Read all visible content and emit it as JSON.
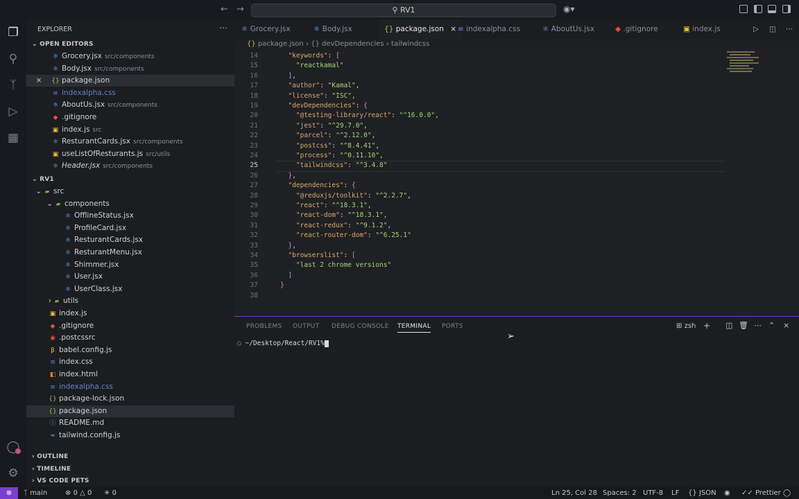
{
  "title": "RV1",
  "sidebar": {
    "header": "EXPLORER",
    "open_editors_label": "OPEN EDITORS",
    "open_editors": [
      {
        "name": "Grocery.jsx",
        "desc": "src/components",
        "icon": "react-icon",
        "color": "#5fb3ff"
      },
      {
        "name": "Body.jsx",
        "desc": "src/components",
        "icon": "react-icon",
        "color": "#5fb3ff"
      },
      {
        "name": "package.json",
        "desc": "",
        "icon": "json-icon",
        "color": "#c8b45a"
      },
      {
        "name": "indexalpha.css",
        "desc": "",
        "icon": "css-icon",
        "color": "#5a84e6"
      },
      {
        "name": "AboutUs.jsx",
        "desc": "src/components",
        "icon": "react-icon",
        "color": "#5fb3ff"
      },
      {
        "name": ".gitignore",
        "desc": "",
        "icon": "git-icon",
        "color": "#e0503a"
      },
      {
        "name": "index.js",
        "desc": "src",
        "icon": "js-icon",
        "color": "#e6c03a"
      },
      {
        "name": "ResturantCards.jsx",
        "desc": "src/components",
        "icon": "react-icon",
        "color": "#5fb3ff"
      },
      {
        "name": "useListOfResturants.js",
        "desc": "src/utils",
        "icon": "js-icon",
        "color": "#e6c03a"
      },
      {
        "name": "Header.jsx",
        "desc": "src/components",
        "icon": "react-icon",
        "color": "#5fb3ff"
      }
    ],
    "project_label": "RV1",
    "tree": [
      {
        "name": "src",
        "icon": "folder-icon",
        "color": "#6aa84f"
      },
      {
        "name": "components",
        "icon": "folder-icon",
        "color": "#6aa84f"
      },
      {
        "name": "OfflineStatus.jsx",
        "icon": "react-icon",
        "color": "#5fb3ff"
      },
      {
        "name": "ProfileCard.jsx",
        "icon": "react-icon",
        "color": "#5fb3ff"
      },
      {
        "name": "ResturantCards.jsx",
        "icon": "react-icon",
        "color": "#5fb3ff"
      },
      {
        "name": "ResturantMenu.jsx",
        "icon": "react-icon",
        "color": "#5fb3ff"
      },
      {
        "name": "Shimmer.jsx",
        "icon": "react-icon",
        "color": "#5fb3ff"
      },
      {
        "name": "User.jsx",
        "icon": "react-icon",
        "color": "#5fb3ff"
      },
      {
        "name": "UserClass.jsx",
        "icon": "react-icon",
        "color": "#5fb3ff"
      },
      {
        "name": "utils",
        "icon": "folder-icon",
        "color": "#6aa84f"
      },
      {
        "name": "index.js",
        "icon": "js-icon",
        "color": "#e6c03a"
      },
      {
        "name": ".gitignore",
        "icon": "git-icon",
        "color": "#e0503a"
      },
      {
        "name": ".postcssrc",
        "icon": "postcss-icon",
        "color": "#e0503a"
      },
      {
        "name": "babel.config.js",
        "icon": "babel-icon",
        "color": "#e6c03a"
      },
      {
        "name": "index.css",
        "icon": "css-icon",
        "color": "#5a84e6"
      },
      {
        "name": "index.html",
        "icon": "html-icon",
        "color": "#e37933"
      },
      {
        "name": "indexalpha.css",
        "icon": "css-icon",
        "color": "#5a84e6"
      },
      {
        "name": "package-lock.json",
        "icon": "json-icon",
        "color": "#8bc34a"
      },
      {
        "name": "package.json",
        "icon": "json-icon",
        "color": "#8bc34a"
      },
      {
        "name": "README.md",
        "icon": "info-icon",
        "color": "#4a90e2"
      },
      {
        "name": "tailwind.config.js",
        "icon": "tailwind-icon",
        "color": "#38bdf8"
      }
    ],
    "outline_label": "OUTLINE",
    "timeline_label": "TIMELINE",
    "pets_label": "VS CODE PETS"
  },
  "tabs": [
    {
      "label": "Grocery.jsx"
    },
    {
      "label": "Body.jsx"
    },
    {
      "label": "package.json"
    },
    {
      "label": "indexalpha.css"
    },
    {
      "label": "AboutUs.jsx"
    },
    {
      "label": ".gitignore"
    },
    {
      "label": "index.js"
    }
  ],
  "breadcrumb": [
    "package.json",
    "{} devDependencies",
    "tailwindcss"
  ],
  "code_lines": [
    {
      "n": "14",
      "t": "  \"keywords\": ["
    },
    {
      "n": "15",
      "t": "    \"reactkamal\""
    },
    {
      "n": "16",
      "t": "  ],"
    },
    {
      "n": "17",
      "t": "  \"author\": \"Kamal\","
    },
    {
      "n": "18",
      "t": "  \"license\": \"ISC\","
    },
    {
      "n": "19",
      "t": "  \"devDependencies\": {"
    },
    {
      "n": "20",
      "t": "    \"@testing-library/react\": \"^16.0.0\","
    },
    {
      "n": "21",
      "t": "    \"jest\": \"^29.7.0\","
    },
    {
      "n": "22",
      "t": "    \"parcel\": \"^2.12.0\","
    },
    {
      "n": "23",
      "t": "    \"postcss\": \"^8.4.41\","
    },
    {
      "n": "24",
      "t": "    \"process\": \"^0.11.10\","
    },
    {
      "n": "25",
      "t": "    \"tailwindcss\": \"^3.4.8\""
    },
    {
      "n": "26",
      "t": "  },"
    },
    {
      "n": "27",
      "t": "  \"dependencies\": {"
    },
    {
      "n": "28",
      "t": "    \"@reduxjs/toolkit\": \"^2.2.7\","
    },
    {
      "n": "29",
      "t": "    \"react\": \"^18.3.1\","
    },
    {
      "n": "30",
      "t": "    \"react-dom\": \"^18.3.1\","
    },
    {
      "n": "31",
      "t": "    \"react-redux\": \"^9.1.2\","
    },
    {
      "n": "32",
      "t": "    \"react-router-dom\": \"^6.25.1\""
    },
    {
      "n": "33",
      "t": "  },"
    },
    {
      "n": "34",
      "t": "  \"browserslist\": ["
    },
    {
      "n": "35",
      "t": "    \"last 2 chrome versions\""
    },
    {
      "n": "36",
      "t": "  ]"
    },
    {
      "n": "37",
      "t": "}"
    },
    {
      "n": "38",
      "t": ""
    }
  ],
  "panel": {
    "tabs": [
      "PROBLEMS",
      "OUTPUT",
      "DEBUG CONSOLE",
      "TERMINAL",
      "PORTS"
    ],
    "shell": "zsh",
    "prompt": "~/Desktop/React/RV1%"
  },
  "status": {
    "branch": "main",
    "errors": "0",
    "warnings": "0",
    "ports": "0",
    "position": "Ln 25, Col 28",
    "spaces": "Spaces: 2",
    "encoding": "UTF-8",
    "eol": "LF",
    "language": "JSON",
    "formatter": "Prettier"
  },
  "colors": {
    "accent": "#7a3fd1",
    "panel_border": "#6d3fb8"
  }
}
